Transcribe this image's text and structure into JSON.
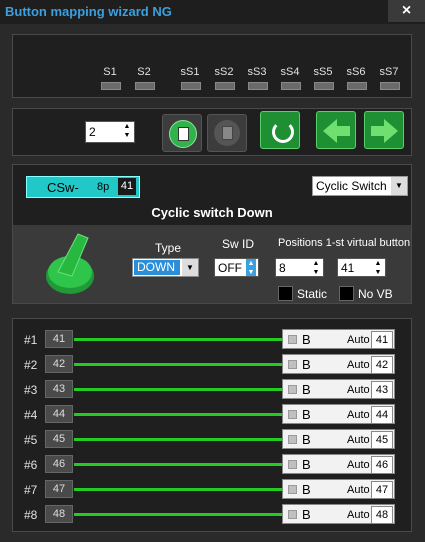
{
  "window": {
    "title": "Button mapping wizard NG",
    "close_label": "×"
  },
  "slots": [
    "S1",
    "S2",
    "sS1",
    "sS2",
    "sS3",
    "sS4",
    "sS5",
    "sS6",
    "sS7"
  ],
  "toolbar": {
    "page_value": "2"
  },
  "mode": {
    "button_label": "CSw-",
    "positions": "8p",
    "number": "41",
    "dropdown_value": "Cyclic Switch",
    "heading": "Cyclic switch Down"
  },
  "config": {
    "type_label": "Type",
    "type_value": "DOWN",
    "swid_label": "Sw ID",
    "swid_value": "OFF",
    "pos_label": "Positions 1-st virtual button",
    "positions_value": "8",
    "virtual_value": "41",
    "static_label": "Static",
    "novb_label": "No VB"
  },
  "rows": [
    {
      "label": "#1",
      "value": "41",
      "b": "B",
      "auto": "Auto",
      "num": "41"
    },
    {
      "label": "#2",
      "value": "42",
      "b": "B",
      "auto": "Auto",
      "num": "42"
    },
    {
      "label": "#3",
      "value": "43",
      "b": "B",
      "auto": "Auto",
      "num": "43"
    },
    {
      "label": "#4",
      "value": "44",
      "b": "B",
      "auto": "Auto",
      "num": "44"
    },
    {
      "label": "#5",
      "value": "45",
      "b": "B",
      "auto": "Auto",
      "num": "45"
    },
    {
      "label": "#6",
      "value": "46",
      "b": "B",
      "auto": "Auto",
      "num": "46"
    },
    {
      "label": "#7",
      "value": "47",
      "b": "B",
      "auto": "Auto",
      "num": "47"
    },
    {
      "label": "#8",
      "value": "48",
      "b": "B",
      "auto": "Auto",
      "num": "48"
    }
  ],
  "colors": {
    "accent_cyan": "#22c8c8",
    "line_green": "#22cc22",
    "title_blue": "#3aa0e0"
  }
}
